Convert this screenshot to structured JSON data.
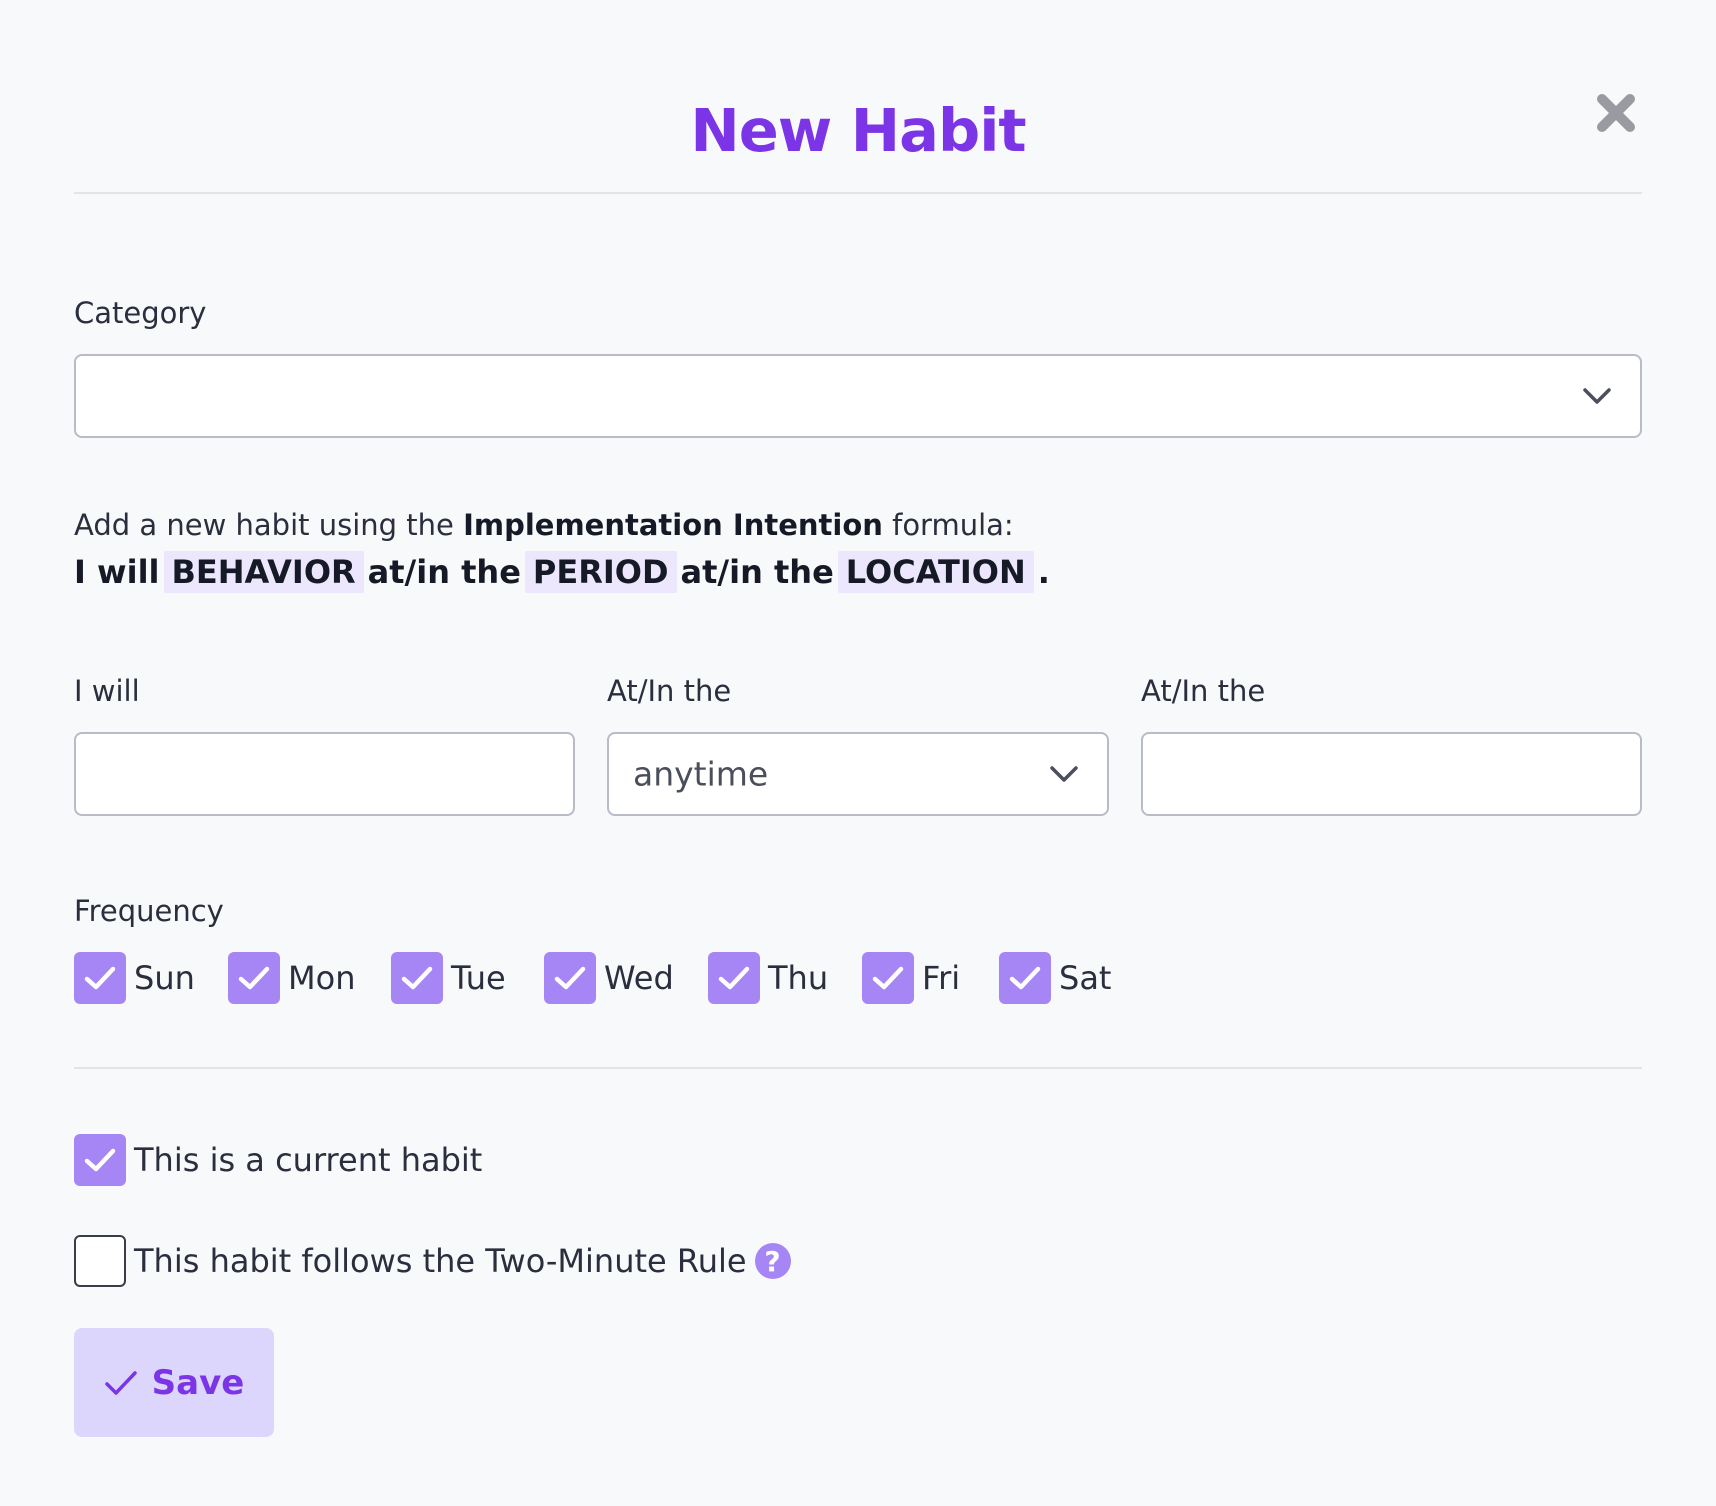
{
  "modal": {
    "title": "New Habit"
  },
  "category": {
    "label": "Category",
    "value": ""
  },
  "intro": {
    "prefix": "Add a new habit using the ",
    "emphasis": "Implementation Intention",
    "suffix": " formula:"
  },
  "formula": {
    "p1": "I will",
    "t1": "BEHAVIOR",
    "p2": "at/in the",
    "t2": "PERIOD",
    "p3": "at/in the",
    "t3": "LOCATION",
    "end": "."
  },
  "fields": {
    "will_label": "I will",
    "will_value": "",
    "period_label": "At/In the",
    "period_value": "anytime",
    "location_label": "At/In the",
    "location_value": ""
  },
  "frequency": {
    "label": "Frequency",
    "days": [
      {
        "label": "Sun",
        "checked": true
      },
      {
        "label": "Mon",
        "checked": true
      },
      {
        "label": "Tue",
        "checked": true
      },
      {
        "label": "Wed",
        "checked": true
      },
      {
        "label": "Thu",
        "checked": true
      },
      {
        "label": "Fri",
        "checked": true
      },
      {
        "label": "Sat",
        "checked": true
      }
    ]
  },
  "options": {
    "current_label": "This is a current habit",
    "current_checked": true,
    "two_minute_label": "This habit follows the Two-Minute Rule",
    "two_minute_checked": false,
    "help_glyph": "?"
  },
  "save": {
    "label": "Save"
  },
  "colors": {
    "accent": "#7b35e6",
    "checkbox": "#a685f4",
    "save_bg": "#ddd6fc",
    "token_bg": "#ece7fd"
  }
}
